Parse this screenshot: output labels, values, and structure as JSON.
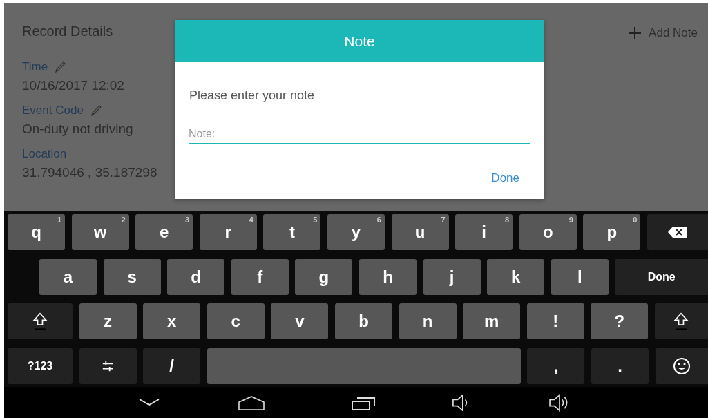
{
  "record": {
    "title": "Record Details",
    "add_note": "Add Note",
    "fields": [
      {
        "label": "Time",
        "value": "10/16/2017 12:02",
        "editable": true
      },
      {
        "label": "Event Code",
        "value": "On-duty not driving",
        "editable": true
      },
      {
        "label": "Location",
        "value": "31.794046 , 35.187298",
        "editable": false
      }
    ]
  },
  "dialog": {
    "title": "Note",
    "message": "Please enter your note",
    "field": {
      "placeholder": "Note:"
    },
    "button": "Done"
  },
  "keyboard": {
    "rows": [
      {
        "keys": [
          {
            "kind": "letter",
            "label": "q",
            "hint": "1"
          },
          {
            "kind": "letter",
            "label": "w",
            "hint": "2"
          },
          {
            "kind": "letter",
            "label": "e",
            "hint": "3"
          },
          {
            "kind": "letter",
            "label": "r",
            "hint": "4"
          },
          {
            "kind": "letter",
            "label": "t",
            "hint": "5"
          },
          {
            "kind": "letter",
            "label": "y",
            "hint": "6"
          },
          {
            "kind": "letter",
            "label": "u",
            "hint": "7"
          },
          {
            "kind": "letter",
            "label": "i",
            "hint": "8"
          },
          {
            "kind": "letter",
            "label": "o",
            "hint": "9"
          },
          {
            "kind": "letter",
            "label": "p",
            "hint": "0"
          },
          {
            "kind": "backspace"
          }
        ]
      },
      {
        "keys": [
          {
            "kind": "letter",
            "label": "a"
          },
          {
            "kind": "letter",
            "label": "s"
          },
          {
            "kind": "letter",
            "label": "d"
          },
          {
            "kind": "letter",
            "label": "f"
          },
          {
            "kind": "letter",
            "label": "g"
          },
          {
            "kind": "letter",
            "label": "h"
          },
          {
            "kind": "letter",
            "label": "j"
          },
          {
            "kind": "letter",
            "label": "k"
          },
          {
            "kind": "letter",
            "label": "l"
          },
          {
            "kind": "action",
            "label": "Done"
          }
        ]
      },
      {
        "keys": [
          {
            "kind": "shift"
          },
          {
            "kind": "letter",
            "label": "z"
          },
          {
            "kind": "letter",
            "label": "x"
          },
          {
            "kind": "letter",
            "label": "c"
          },
          {
            "kind": "letter",
            "label": "v"
          },
          {
            "kind": "letter",
            "label": "b"
          },
          {
            "kind": "letter",
            "label": "n"
          },
          {
            "kind": "letter",
            "label": "m"
          },
          {
            "kind": "letter",
            "label": "!"
          },
          {
            "kind": "letter",
            "label": "?"
          },
          {
            "kind": "shift"
          }
        ]
      },
      {
        "keys": [
          {
            "kind": "symbols",
            "label": "?123"
          },
          {
            "kind": "settings"
          },
          {
            "kind": "function",
            "label": "/"
          },
          {
            "kind": "space"
          },
          {
            "kind": "function",
            "label": ","
          },
          {
            "kind": "function",
            "label": "."
          },
          {
            "kind": "emoji"
          }
        ]
      }
    ]
  },
  "nav_bar": {
    "buttons": [
      {
        "kind": "back"
      },
      {
        "kind": "home"
      },
      {
        "kind": "recents"
      },
      {
        "kind": "volume_down"
      },
      {
        "kind": "volume_up"
      }
    ]
  }
}
